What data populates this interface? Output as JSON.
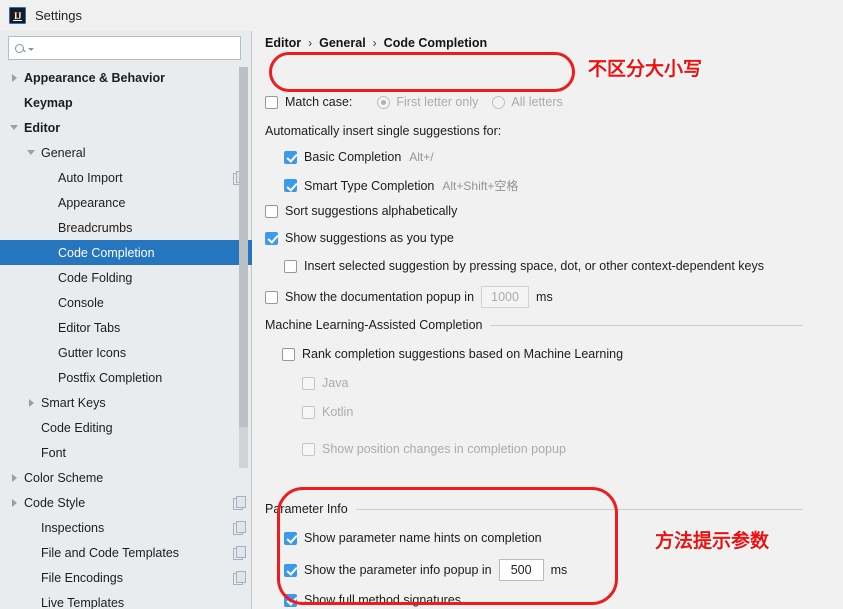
{
  "window": {
    "title": "Settings",
    "app_icon": "intellij-idea-icon"
  },
  "sidebar": {
    "search": {
      "value": "",
      "placeholder": ""
    },
    "items": [
      {
        "label": "Appearance & Behavior",
        "indent": 0,
        "twisty": "collapsed",
        "bold": true,
        "selected": false,
        "copy": false
      },
      {
        "label": "Keymap",
        "indent": 0,
        "twisty": "none",
        "bold": true,
        "selected": false,
        "copy": false
      },
      {
        "label": "Editor",
        "indent": 0,
        "twisty": "expanded",
        "bold": true,
        "selected": false,
        "copy": false
      },
      {
        "label": "General",
        "indent": 1,
        "twisty": "expanded",
        "bold": false,
        "selected": false,
        "copy": false
      },
      {
        "label": "Auto Import",
        "indent": 2,
        "twisty": "none",
        "bold": false,
        "selected": false,
        "copy": true
      },
      {
        "label": "Appearance",
        "indent": 2,
        "twisty": "none",
        "bold": false,
        "selected": false,
        "copy": false
      },
      {
        "label": "Breadcrumbs",
        "indent": 2,
        "twisty": "none",
        "bold": false,
        "selected": false,
        "copy": false
      },
      {
        "label": "Code Completion",
        "indent": 2,
        "twisty": "none",
        "bold": false,
        "selected": true,
        "copy": false
      },
      {
        "label": "Code Folding",
        "indent": 2,
        "twisty": "none",
        "bold": false,
        "selected": false,
        "copy": false
      },
      {
        "label": "Console",
        "indent": 2,
        "twisty": "none",
        "bold": false,
        "selected": false,
        "copy": false
      },
      {
        "label": "Editor Tabs",
        "indent": 2,
        "twisty": "none",
        "bold": false,
        "selected": false,
        "copy": false
      },
      {
        "label": "Gutter Icons",
        "indent": 2,
        "twisty": "none",
        "bold": false,
        "selected": false,
        "copy": false
      },
      {
        "label": "Postfix Completion",
        "indent": 2,
        "twisty": "none",
        "bold": false,
        "selected": false,
        "copy": false
      },
      {
        "label": "Smart Keys",
        "indent": 1,
        "twisty": "collapsed",
        "bold": false,
        "selected": false,
        "copy": false
      },
      {
        "label": "Code Editing",
        "indent": 1,
        "twisty": "none",
        "bold": false,
        "selected": false,
        "copy": false
      },
      {
        "label": "Font",
        "indent": 1,
        "twisty": "none",
        "bold": false,
        "selected": false,
        "copy": false
      },
      {
        "label": "Color Scheme",
        "indent": 0,
        "twisty": "collapsed",
        "bold": false,
        "selected": false,
        "copy": false
      },
      {
        "label": "Code Style",
        "indent": 0,
        "twisty": "collapsed",
        "bold": false,
        "selected": false,
        "copy": true
      },
      {
        "label": "Inspections",
        "indent": 1,
        "twisty": "none",
        "bold": false,
        "selected": false,
        "copy": true
      },
      {
        "label": "File and Code Templates",
        "indent": 1,
        "twisty": "none",
        "bold": false,
        "selected": false,
        "copy": true
      },
      {
        "label": "File Encodings",
        "indent": 1,
        "twisty": "none",
        "bold": false,
        "selected": false,
        "copy": true
      },
      {
        "label": "Live Templates",
        "indent": 1,
        "twisty": "none",
        "bold": false,
        "selected": false,
        "copy": false
      }
    ]
  },
  "breadcrumb": {
    "parts": [
      "Editor",
      "General",
      "Code Completion"
    ],
    "separator": "›"
  },
  "main": {
    "match_case": {
      "label": "Match case:",
      "checked": false,
      "options": [
        {
          "label": "First letter only",
          "selected": true,
          "disabled": true
        },
        {
          "label": "All letters",
          "selected": false,
          "disabled": true
        }
      ]
    },
    "auto_insert_label": "Automatically insert single suggestions for:",
    "auto_insert_items": [
      {
        "label": "Basic Completion",
        "shortcut": "Alt+/",
        "checked": true
      },
      {
        "label": "Smart Type Completion",
        "shortcut": "Alt+Shift+空格",
        "checked": true
      }
    ],
    "sort_alphabetically": {
      "label": "Sort suggestions alphabetically",
      "checked": false
    },
    "show_as_you_type": {
      "label": "Show suggestions as you type",
      "checked": true
    },
    "insert_selected": {
      "label": "Insert selected suggestion by pressing space, dot, or other context-dependent keys",
      "checked": false
    },
    "doc_popup": {
      "label": "Show the documentation popup in",
      "checked": false,
      "value": "1000",
      "unit": "ms",
      "disabled": true
    },
    "ml_group": {
      "title": "Machine Learning-Assisted Completion",
      "rank": {
        "label": "Rank completion suggestions based on Machine Learning",
        "checked": false
      },
      "children": [
        {
          "label": "Java",
          "checked": false,
          "disabled": true
        },
        {
          "label": "Kotlin",
          "checked": false,
          "disabled": true
        }
      ],
      "position_changes": {
        "label": "Show position changes in completion popup",
        "checked": false,
        "disabled": true
      }
    },
    "param_group": {
      "title": "Parameter Info",
      "name_hints": {
        "label": "Show parameter name hints on completion",
        "checked": true
      },
      "popup": {
        "label": "Show the parameter info popup in",
        "checked": true,
        "value": "500",
        "unit": "ms",
        "disabled": false
      },
      "full_signatures": {
        "label": "Show full method signatures",
        "checked": true
      }
    }
  },
  "annotations": [
    {
      "text": "不区分大小写",
      "color": "#f01010"
    },
    {
      "text": "方法提示参数",
      "color": "#f01010"
    }
  ],
  "colors": {
    "selection": "#2675bf",
    "checkbox_checked": "#3d9ae8",
    "annotation_red": "#ee1c1c",
    "sidebar_bg": "#e8ecef",
    "main_bg": "#f1f1f1"
  }
}
